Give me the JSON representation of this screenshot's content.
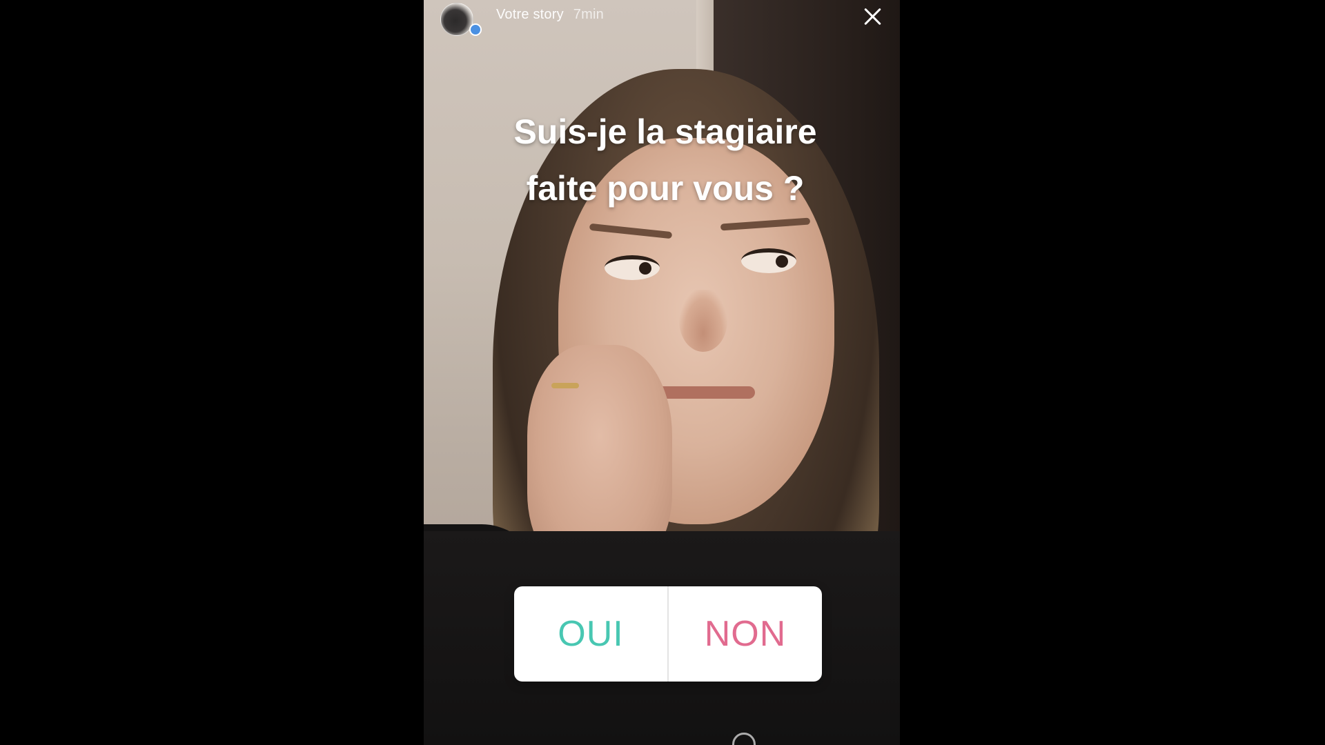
{
  "story": {
    "label": "Votre story",
    "time": "7min",
    "question_line1": "Suis-je la stagiaire",
    "question_line2": "faite pour vous ?",
    "poll": {
      "yes": "OUI",
      "no": "NON",
      "yes_color": "#48c7b2",
      "no_color": "#e16b8f"
    }
  },
  "icons": {
    "close": "close-icon",
    "avatar": "avatar",
    "badge": "story-badge-icon",
    "bottom": "activity-icon"
  }
}
